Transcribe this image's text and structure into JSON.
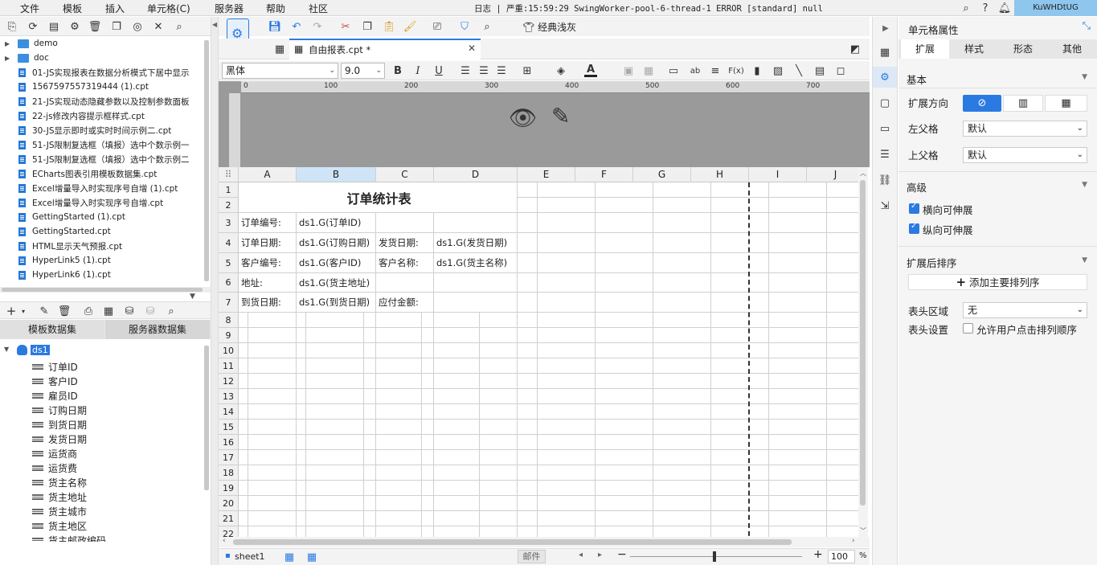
{
  "menubar": {
    "items": [
      "文件",
      "模板",
      "插入",
      "单元格(C)",
      "服务器",
      "帮助",
      "社区"
    ],
    "log": "日志 | 严重:15:59:29 SwingWorker-pool-6-thread-1 ERROR [standard] null",
    "user": "KuWHDtUG"
  },
  "filetree": {
    "items": [
      {
        "type": "folder",
        "label": "demo"
      },
      {
        "type": "folder",
        "label": "doc"
      },
      {
        "type": "file",
        "label": "01-JS实现报表在数据分析模式下居中显示"
      },
      {
        "type": "file",
        "label": "1567597557319444 (1).cpt"
      },
      {
        "type": "file",
        "label": "21-JS实现动态隐藏参数以及控制参数面板"
      },
      {
        "type": "file",
        "label": "22-js修改内容提示框样式.cpt"
      },
      {
        "type": "file",
        "label": "30-JS显示即时或实时时间示例二.cpt"
      },
      {
        "type": "file",
        "label": "51-JS限制复选框（填报）选中个数示例一"
      },
      {
        "type": "file",
        "label": "51-JS限制复选框（填报）选中个数示例二"
      },
      {
        "type": "file",
        "label": "ECharts图表引用模板数据集.cpt"
      },
      {
        "type": "file",
        "label": "Excel增量导入时实现序号自增 (1).cpt"
      },
      {
        "type": "file",
        "label": "Excel增量导入时实现序号自增.cpt"
      },
      {
        "type": "file",
        "label": "GettingStarted (1).cpt"
      },
      {
        "type": "file",
        "label": "GettingStarted.cpt"
      },
      {
        "type": "file",
        "label": "HTML显示天气预报.cpt"
      },
      {
        "type": "file",
        "label": "HyperLink5 (1).cpt"
      },
      {
        "type": "file",
        "label": "HyperLink6 (1).cpt"
      }
    ]
  },
  "datasets": {
    "tabs": [
      "模板数据集",
      "服务器数据集"
    ],
    "ds_name": "ds1",
    "fields": [
      "订单ID",
      "客户ID",
      "雇员ID",
      "订购日期",
      "到货日期",
      "发货日期",
      "运货商",
      "运货费",
      "货主名称",
      "货主地址",
      "货主城市",
      "货主地区",
      "货主邮政编码"
    ]
  },
  "toolbar": {
    "classic_label": "经典浅灰"
  },
  "editor": {
    "tab_title": "自由报表.cpt *"
  },
  "format": {
    "font": "黑体",
    "size": "9.0"
  },
  "ruler": {
    "marks": [
      "0",
      "100",
      "200",
      "300",
      "400",
      "500",
      "600",
      "700"
    ]
  },
  "grid": {
    "columns": [
      "A",
      "B",
      "C",
      "D",
      "E",
      "F",
      "G",
      "H",
      "I",
      "J"
    ],
    "rows": [
      "1",
      "2",
      "3",
      "4",
      "5",
      "6",
      "7",
      "8",
      "9",
      "10",
      "11",
      "12",
      "13",
      "14",
      "15",
      "16",
      "17",
      "18",
      "19",
      "20",
      "21",
      "22"
    ],
    "title": "订单统计表",
    "cells": {
      "a3": "订单编号:",
      "b3": "ds1.G(订单ID)",
      "a4": "订单日期:",
      "b4": "ds1.G(订购日期)",
      "c4": "发货日期:",
      "d4": "ds1.G(发货日期)",
      "a5": "客户编号:",
      "b5": "ds1.G(客户ID)",
      "c5": "客户名称:",
      "d5": "ds1.G(货主名称)",
      "a6": "地址:",
      "b6": "ds1.G(货主地址)",
      "a7": "到货日期:",
      "b7": "ds1.G(到货日期)",
      "c7": "应付金额:"
    }
  },
  "bottombar": {
    "sheet": "sheet1",
    "mail": "邮件",
    "zoom": "100",
    "pct": "%"
  },
  "rightpanel": {
    "title": "单元格属性",
    "tabs": [
      "扩展",
      "样式",
      "形态",
      "其他"
    ],
    "basic": "基本",
    "expand_dir": "扩展方向",
    "left_parent": "左父格",
    "left_parent_val": "默认",
    "top_parent": "上父格",
    "top_parent_val": "默认",
    "advanced": "高级",
    "h_expand": "横向可伸展",
    "v_expand": "纵向可伸展",
    "sort_after": "扩展后排序",
    "add_sort": "添加主要排列序",
    "header_area": "表头区域",
    "header_area_val": "无",
    "header_settings": "表头设置",
    "allow_sort": "允许用户点击排列顺序"
  },
  "colors": {
    "accent": "#2a7ae2",
    "selected_col": "#cfe4f7",
    "userbox": "#8ec6ee"
  }
}
